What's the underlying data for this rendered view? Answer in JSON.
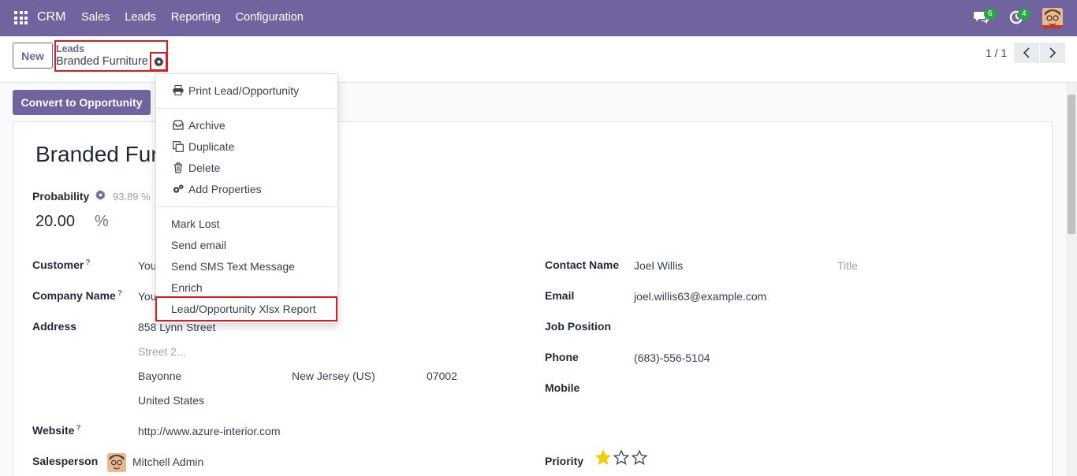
{
  "navbar": {
    "brand": "CRM",
    "menu": [
      "Sales",
      "Leads",
      "Reporting",
      "Configuration"
    ],
    "chat_count": "6",
    "activity_count": "4",
    "bg_color": "#71639e"
  },
  "control": {
    "new_label": "New",
    "breadcrumb_parent": "Leads",
    "breadcrumb_current": "Branded Furniture",
    "pager": "1 / 1"
  },
  "actions": {
    "convert_label": "Convert to Opportunity"
  },
  "dropdown": {
    "print": "Print Lead/Opportunity",
    "archive": "Archive",
    "duplicate": "Duplicate",
    "delete": "Delete",
    "add_properties": "Add Properties",
    "mark_lost": "Mark Lost",
    "send_email": "Send email",
    "send_sms": "Send SMS Text Message",
    "enrich": "Enrich",
    "xlsx_report": "Lead/Opportunity Xlsx Report"
  },
  "form": {
    "title": "Branded Fur",
    "probability_label": "Probability",
    "probability_auto": "93.89 %",
    "probability_value": "20.00",
    "probability_unit": "%",
    "customer_label": "Customer",
    "customer_value": "You",
    "company_label": "Company Name",
    "company_value": "You",
    "address_label": "Address",
    "street": "858 Lynn Street",
    "street2_placeholder": "Street 2...",
    "city": "Bayonne",
    "state": "New Jersey (US)",
    "zip": "07002",
    "country": "United States",
    "website_label": "Website",
    "website_value": "http://www.azure-interior.com",
    "salesperson_label": "Salesperson",
    "salesperson_value": "Mitchell Admin",
    "contact_label": "Contact Name",
    "contact_value": "Joel Willis",
    "title_placeholder": "Title",
    "email_label": "Email",
    "email_value": "joel.willis63@example.com",
    "job_label": "Job Position",
    "phone_label": "Phone",
    "phone_value": "(683)-556-5104",
    "mobile_label": "Mobile",
    "priority_label": "Priority",
    "priority_stars": 1,
    "priority_max": 3,
    "help_mark": "?"
  }
}
